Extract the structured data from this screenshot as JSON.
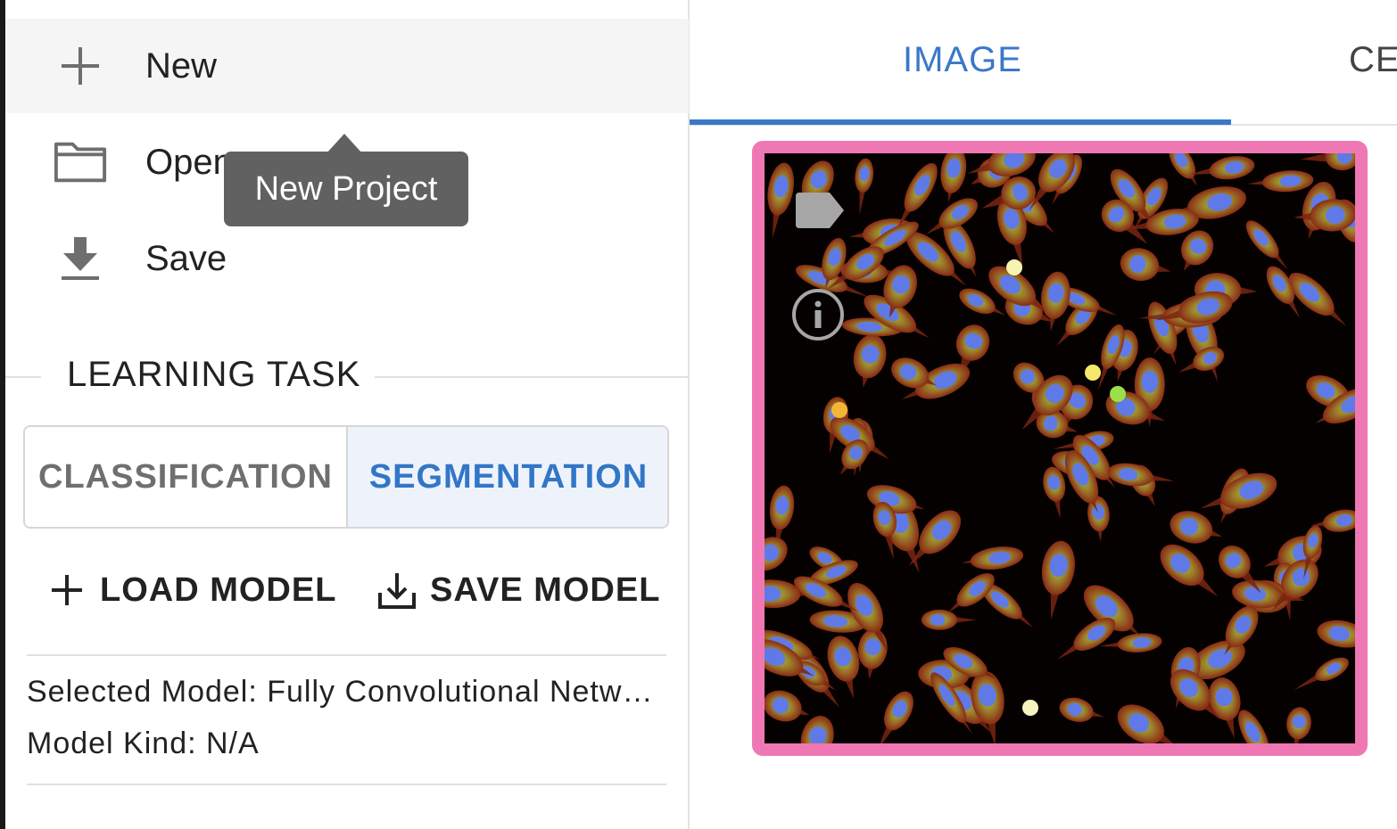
{
  "menu": {
    "new_label": "New",
    "open_label": "Open",
    "save_label": "Save"
  },
  "tooltip": {
    "text": "New Project"
  },
  "learning_task": {
    "title": "LEARNING TASK",
    "options": [
      "CLASSIFICATION",
      "SEGMENTATION"
    ],
    "selected": "SEGMENTATION"
  },
  "model_actions": {
    "load_label": "LOAD MODEL",
    "save_label": "SAVE MODEL"
  },
  "model_info": {
    "selected_model": "Selected Model: Fully Convolutional Network",
    "model_kind": "Model Kind: N/A"
  },
  "tabs": {
    "image_label": "IMAGE",
    "second_label": "CE",
    "active": "IMAGE"
  },
  "colors": {
    "accent": "#3a78c9",
    "image_border": "#ef78b4",
    "tooltip_bg": "#616161"
  },
  "icons": {
    "new": "plus-icon",
    "open": "folder-icon",
    "save": "download-icon",
    "load_model": "plus-icon",
    "save_model": "download-tray-icon",
    "image_tag": "label-tag-icon",
    "image_info": "info-icon"
  }
}
